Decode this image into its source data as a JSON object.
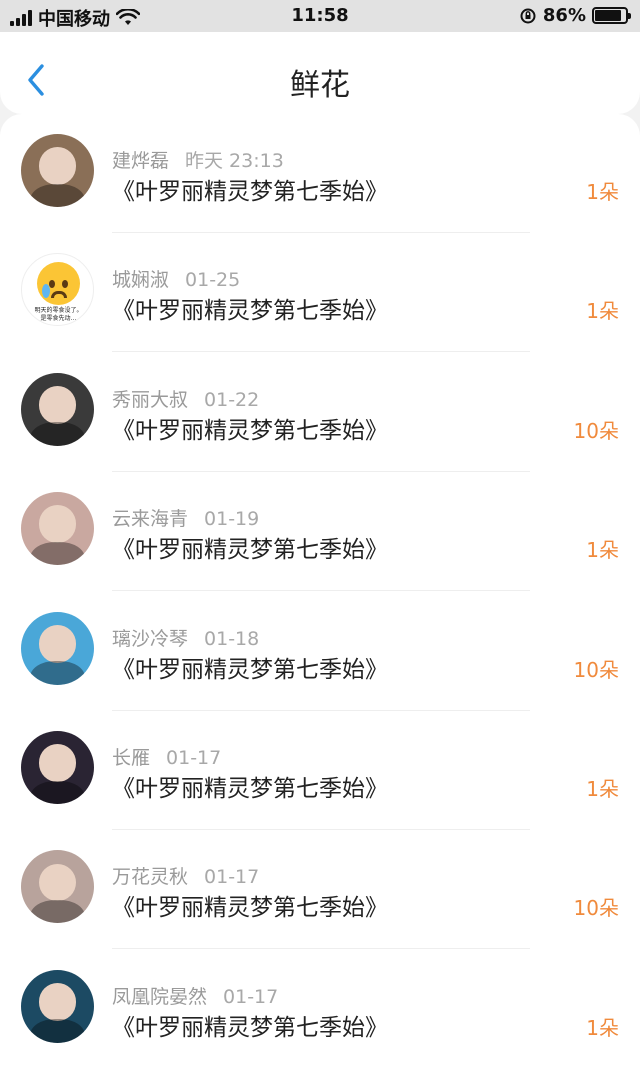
{
  "status_bar": {
    "carrier": "中国移动",
    "time": "11:58",
    "battery": "86%",
    "battery_level": 0.86
  },
  "nav": {
    "title": "鲜花"
  },
  "items": [
    {
      "name": "建烨磊",
      "date": "昨天 23:13",
      "work": "《叶罗丽精灵梦第七季始》",
      "count": "1朵",
      "avatar_bg": "#8a6f57"
    },
    {
      "name": "城娴淑",
      "date": "01-25",
      "work": "《叶罗丽精灵梦第七季始》",
      "count": "1朵",
      "avatar_bg": "#ffffff",
      "avatar_caption": "明天的零食没了。\n是零食先动…"
    },
    {
      "name": "秀丽大叔",
      "date": "01-22",
      "work": "《叶罗丽精灵梦第七季始》",
      "count": "10朵",
      "avatar_bg": "#3a3a3a"
    },
    {
      "name": "云来海青",
      "date": "01-19",
      "work": "《叶罗丽精灵梦第七季始》",
      "count": "1朵",
      "avatar_bg": "#c9a8a0"
    },
    {
      "name": "璃沙冷琴",
      "date": "01-18",
      "work": "《叶罗丽精灵梦第七季始》",
      "count": "10朵",
      "avatar_bg": "#4aa7d8"
    },
    {
      "name": "长雁",
      "date": "01-17",
      "work": "《叶罗丽精灵梦第七季始》",
      "count": "1朵",
      "avatar_bg": "#2a2433"
    },
    {
      "name": "万花灵秋",
      "date": "01-17",
      "work": "《叶罗丽精灵梦第七季始》",
      "count": "10朵",
      "avatar_bg": "#b8a39c"
    },
    {
      "name": "凤凰院晏然",
      "date": "01-17",
      "work": "《叶罗丽精灵梦第七季始》",
      "count": "1朵",
      "avatar_bg": "#1c4a63"
    }
  ],
  "colors": {
    "accent": "#2b8fe0",
    "count": "#f08a3c"
  }
}
